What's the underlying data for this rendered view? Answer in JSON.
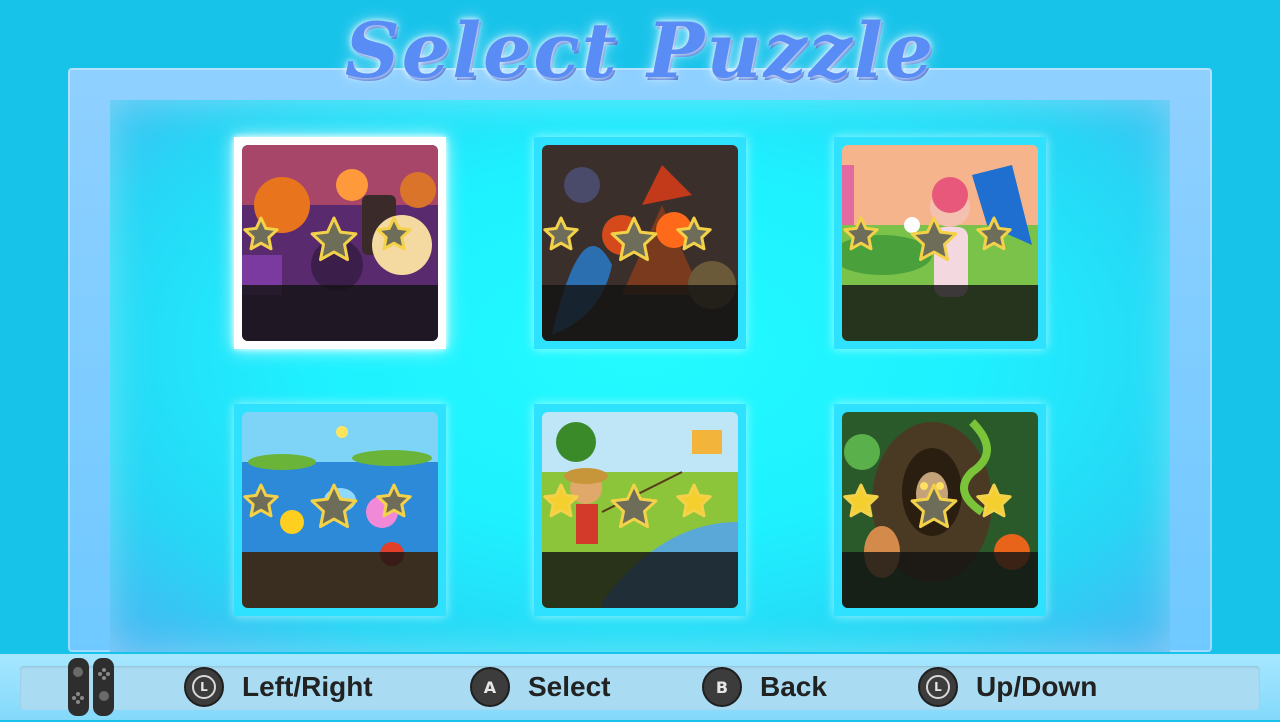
{
  "title": "Select Puzzle",
  "puzzles": [
    {
      "art": "halloween-candles",
      "stars_earned": 0,
      "stars_total": 3,
      "selected": true
    },
    {
      "art": "dragon-volcano",
      "stars_earned": 0,
      "stars_total": 3,
      "selected": false
    },
    {
      "art": "fairy-butterfly",
      "stars_earned": 0,
      "stars_total": 3,
      "selected": false
    },
    {
      "art": "underwater-sea",
      "stars_earned": 0,
      "stars_total": 3,
      "selected": false
    },
    {
      "art": "boy-fishing",
      "stars_earned": 2,
      "stars_total": 3,
      "selected": false
    },
    {
      "art": "forest-owl",
      "stars_earned": 2,
      "stars_total": 3,
      "selected": false
    }
  ],
  "controls": [
    {
      "button": "L",
      "label": "Left/Right",
      "icon": "left-stick-icon"
    },
    {
      "button": "A",
      "label": "Select",
      "icon": "a-button-icon"
    },
    {
      "button": "B",
      "label": "Back",
      "icon": "b-button-icon"
    },
    {
      "button": "L",
      "label": "Up/Down",
      "icon": "left-stick-icon"
    }
  ],
  "colors": {
    "background": "#18c3ea",
    "panel_glow": "#22fbff",
    "title": "#5a8cf5",
    "star_gold": "#f5cf2e",
    "star_empty": "#6d6d5a"
  }
}
